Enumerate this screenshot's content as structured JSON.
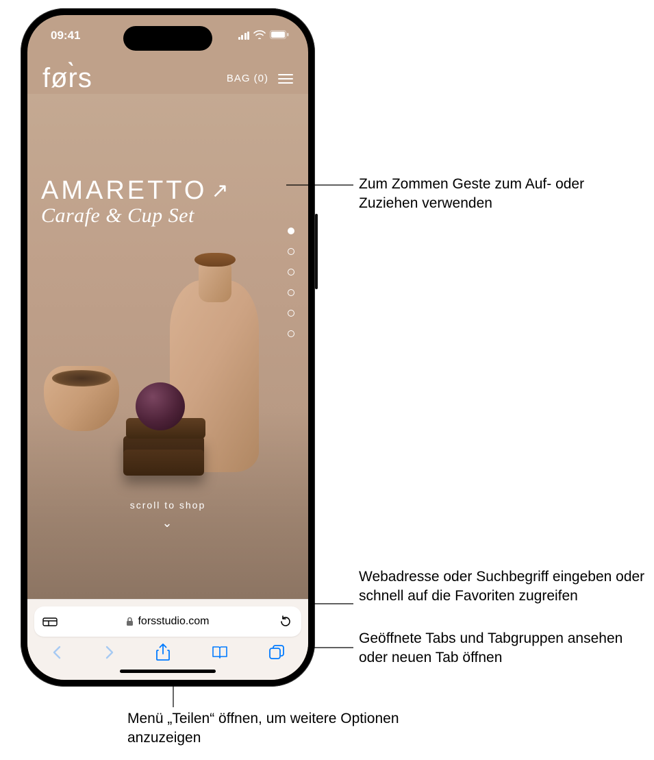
{
  "statusbar": {
    "time": "09:41"
  },
  "site": {
    "logo": "før̀s",
    "bag_label": "BAG (0)"
  },
  "product": {
    "name": "AMARETTO",
    "subtitle": "Carafe & Cup Set"
  },
  "page": {
    "scroll_hint": "scroll to shop",
    "dot_count": 6,
    "active_dot": 0
  },
  "safari": {
    "url": "forsstudio.com"
  },
  "callouts": {
    "pinch": "Zum Zommen Geste zum Auf- oder Zuziehen verwenden",
    "address": "Webadresse oder Suchbegriff eingeben oder schnell auf die Favoriten zugreifen",
    "tabs": "Geöffnete Tabs und Tabgruppen ansehen oder neuen Tab öffnen",
    "share": "Menü „Teilen“ öffnen, um weitere Optionen anzuzeigen"
  }
}
